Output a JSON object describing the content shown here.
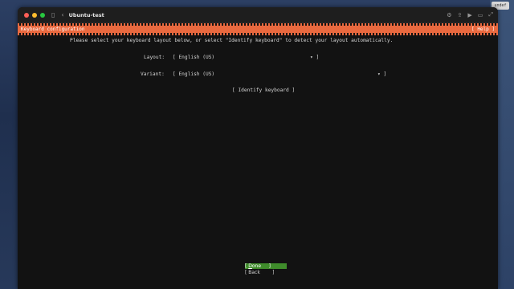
{
  "window": {
    "title": "Ubuntu-test"
  },
  "header": {
    "title": "Keyboard configuration",
    "help": "[ Help ]"
  },
  "instructions": "Please select your keyboard layout below, or select \"Identify keyboard\" to detect your layout automatically.",
  "layout": {
    "label": "Layout:",
    "value": "[ English (US)",
    "arrow": "▾ ]"
  },
  "variant": {
    "label": "Variant:",
    "value": "[ English (US)",
    "arrow": "▾ ]"
  },
  "identify_button": "[ Identify keyboard ]",
  "buttons": {
    "done_open": "[ ",
    "done_first": "D",
    "done_rest": "one",
    "done_close": "     ]",
    "back": "[ Back        ]"
  },
  "colors": {
    "accent": "#e9693f",
    "done_bg": "#3f8c2b",
    "terminal_bg": "#121212"
  },
  "desktop_badge": "undef"
}
